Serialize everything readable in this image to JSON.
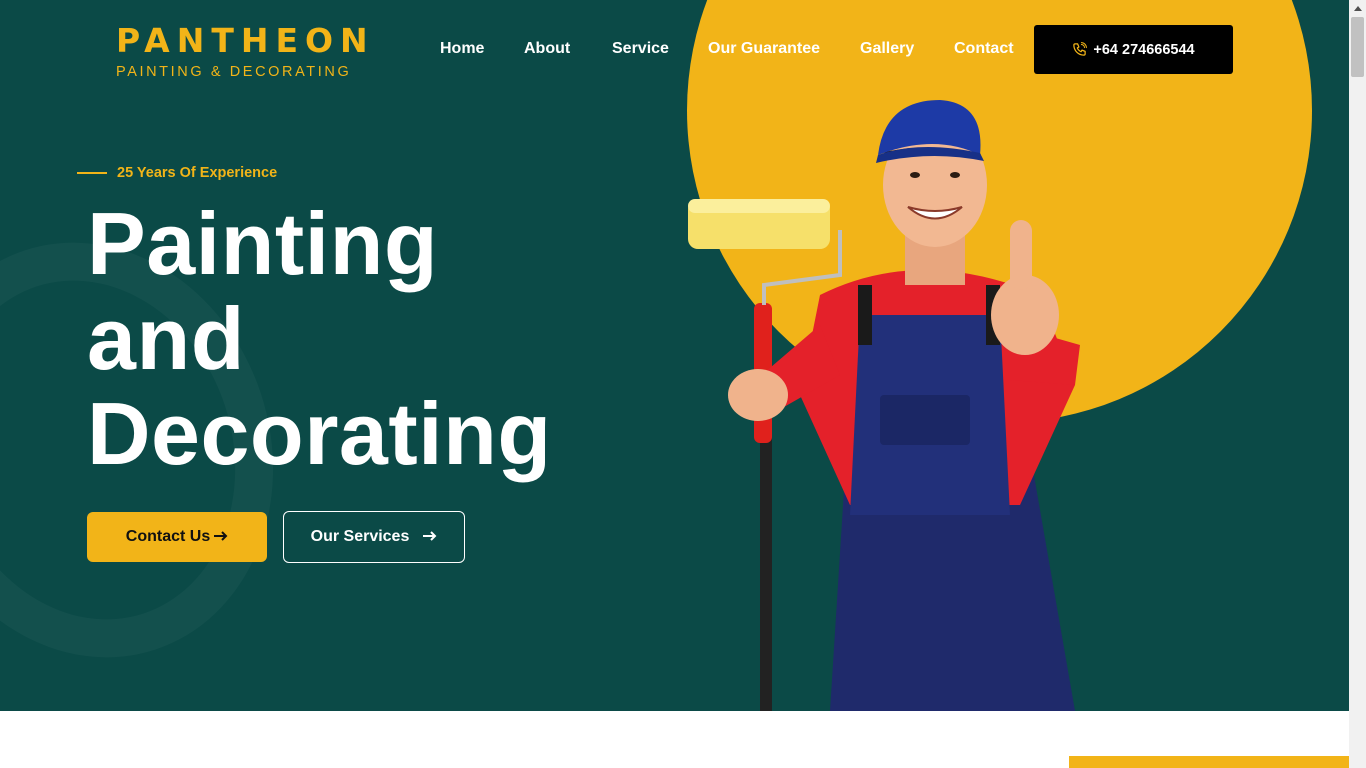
{
  "logo": {
    "main": "PANTHEON",
    "sub": "PAINTING & DECORATING"
  },
  "nav": {
    "items": [
      {
        "label": "Home"
      },
      {
        "label": "About"
      },
      {
        "label": "Service"
      },
      {
        "label": "Our Guarantee"
      },
      {
        "label": "Gallery"
      },
      {
        "label": "Contact"
      }
    ],
    "phone": "+64 274666544",
    "phone_icon": "phone-icon"
  },
  "hero": {
    "eyebrow": "25 Years Of Experience",
    "headline": [
      "Painting",
      "and",
      "Decorating"
    ],
    "primary_button": "Contact Us",
    "secondary_button": "Our Services",
    "arrow_icon": "arrow-right-icon"
  },
  "colors": {
    "background": "#0b4a47",
    "accent": "#f2b418",
    "text": "#ffffff",
    "phone_button": "#000000"
  }
}
